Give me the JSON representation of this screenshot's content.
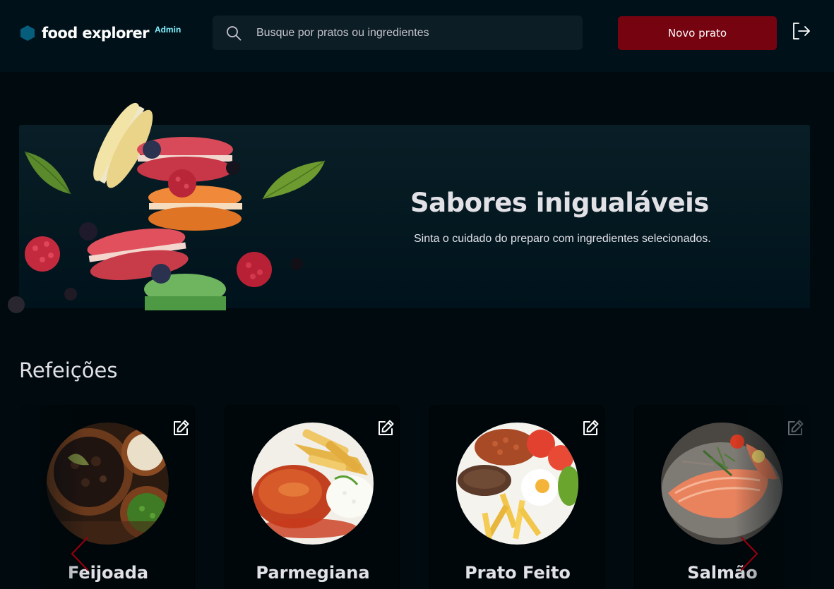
{
  "header": {
    "brand_name": "food explorer",
    "brand_badge": "Admin",
    "search_placeholder": "Busque por pratos ou ingredientes",
    "new_dish_label": "Novo prato"
  },
  "banner": {
    "title": "Sabores inigualáveis",
    "subtitle": "Sinta o cuidado do preparo com ingredientes selecionados."
  },
  "section": {
    "title": "Refeições"
  },
  "dishes": [
    {
      "name": "Feijoada",
      "image": "feijoada-photo"
    },
    {
      "name": "Parmegiana",
      "image": "parmegiana-photo"
    },
    {
      "name": "Prato Feito",
      "image": "prato-feito-photo"
    },
    {
      "name": "Salmão",
      "image": "salmao-photo"
    }
  ],
  "icons": {
    "brand": "hexagon-logo-icon",
    "search": "search-icon",
    "logout": "sign-out-icon",
    "edit": "pencil-square-icon",
    "prev": "chevron-left-icon",
    "next": "chevron-right-icon"
  },
  "colors": {
    "background": "#000a0f",
    "header": "#00111a",
    "accent_button": "#750310",
    "brand_hex": "#065e7c",
    "admin_badge": "#82f3ff",
    "arrow": "#92000e"
  }
}
